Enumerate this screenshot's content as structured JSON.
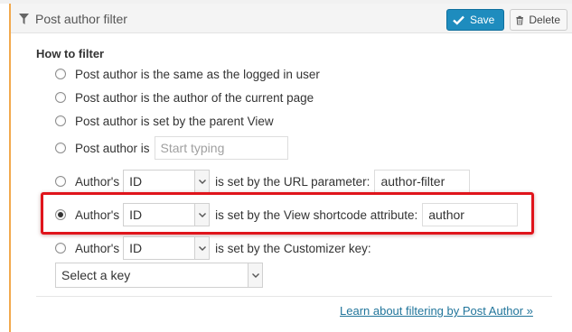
{
  "panel": {
    "title": "Post author filter",
    "save_label": "Save",
    "delete_label": "Delete",
    "accent_color": "#f2a94d",
    "save_color": "#1e8cbe",
    "highlight_color": "#e0141b"
  },
  "how_to_filter": {
    "heading": "How to filter",
    "options": [
      {
        "label": "Post author is the same as the logged in user",
        "selected": false
      },
      {
        "label": "Post author is the author of the current page",
        "selected": false
      },
      {
        "label": "Post author is set by the parent View",
        "selected": false
      },
      {
        "label": "Post author is",
        "input_placeholder": "Start typing",
        "input_value": "",
        "selected": false
      },
      {
        "prefix": "Author's",
        "select_value": "ID",
        "middle": "is set by the URL parameter:",
        "input_value": "author-filter",
        "selected": false
      },
      {
        "prefix": "Author's",
        "select_value": "ID",
        "middle": "is set by the View shortcode attribute:",
        "input_value": "author",
        "selected": true
      },
      {
        "prefix": "Author's",
        "select_value": "ID",
        "middle": "is set by the Customizer key:",
        "key_select_value": "Select a key",
        "selected": false
      }
    ]
  },
  "learn_link": "Learn about filtering by Post Author »"
}
